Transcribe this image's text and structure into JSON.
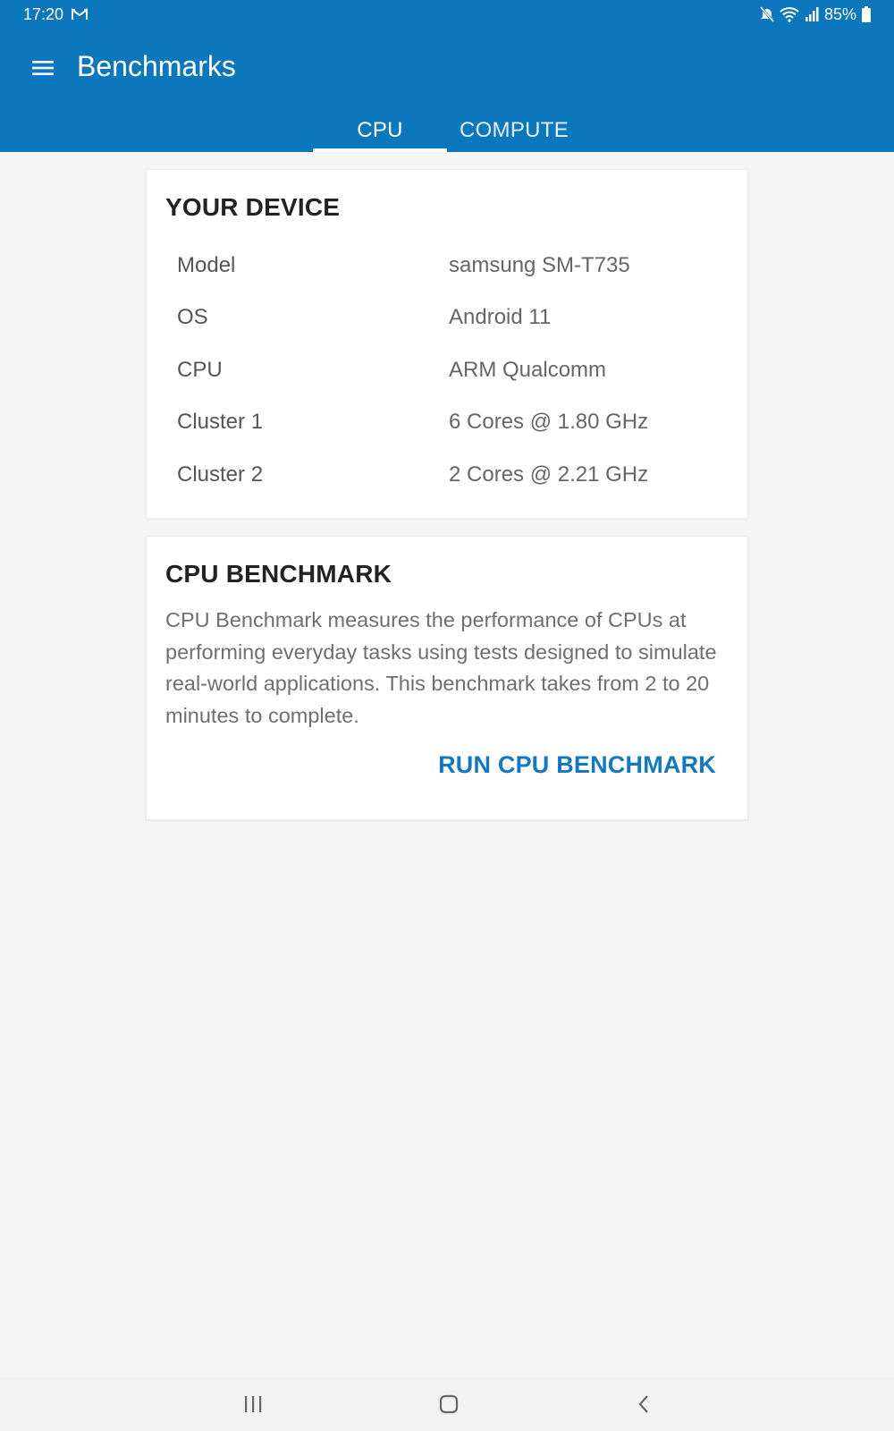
{
  "status_bar": {
    "time": "17:20",
    "notification_icon": "gmail-icon",
    "battery": "85%",
    "icons": [
      "mute-icon",
      "wifi-icon",
      "signal-icon",
      "battery-icon"
    ]
  },
  "app_bar": {
    "title": "Benchmarks",
    "menu_icon": "hamburger-menu-icon",
    "tabs": [
      {
        "label": "CPU",
        "active": true
      },
      {
        "label": "COMPUTE",
        "active": false
      }
    ]
  },
  "device_card": {
    "title": "YOUR DEVICE",
    "rows": [
      {
        "label": "Model",
        "value": "samsung SM-T735"
      },
      {
        "label": "OS",
        "value": "Android 11"
      },
      {
        "label": "CPU",
        "value": "ARM Qualcomm"
      },
      {
        "label": "Cluster 1",
        "value": "6 Cores @ 1.80 GHz"
      },
      {
        "label": "Cluster 2",
        "value": "2 Cores @ 2.21 GHz"
      }
    ]
  },
  "benchmark_card": {
    "title": "CPU BENCHMARK",
    "description": "CPU Benchmark measures the performance of CPUs at performing everyday tasks using tests designed to simulate real-world applications. This benchmark takes from 2 to 20 minutes to complete.",
    "run_label": "RUN CPU BENCHMARK"
  },
  "nav_bar": {
    "buttons": [
      "recent-apps-icon",
      "home-icon",
      "back-icon"
    ]
  },
  "colors": {
    "primary": "#0d77be",
    "accent": "#1378c0",
    "background": "#f5f5f5"
  }
}
